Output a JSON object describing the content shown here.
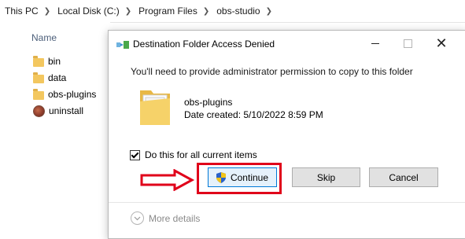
{
  "breadcrumb": [
    "This PC",
    "Local Disk (C:)",
    "Program Files",
    "obs-studio"
  ],
  "file_list": {
    "column_header": "Name",
    "items": [
      {
        "label": "bin",
        "icon": "folder-icon"
      },
      {
        "label": "data",
        "icon": "folder-icon"
      },
      {
        "label": "obs-plugins",
        "icon": "folder-icon"
      },
      {
        "label": "uninstall",
        "icon": "app-icon"
      }
    ]
  },
  "dialog": {
    "title": "Destination Folder Access Denied",
    "message": "You'll need to provide administrator permission to copy to this folder",
    "folder_name": "obs-plugins",
    "date_created": "Date created: 5/10/2022 8:59 PM",
    "checkbox_label": "Do this for all current items",
    "checkbox_checked": true,
    "buttons": {
      "continue": "Continue",
      "skip": "Skip",
      "cancel": "Cancel"
    },
    "more_details": "More details"
  },
  "colors": {
    "highlight_red": "#e0001a",
    "default_button_border": "#0078d7",
    "folder_yellow": "#f3c75f"
  }
}
